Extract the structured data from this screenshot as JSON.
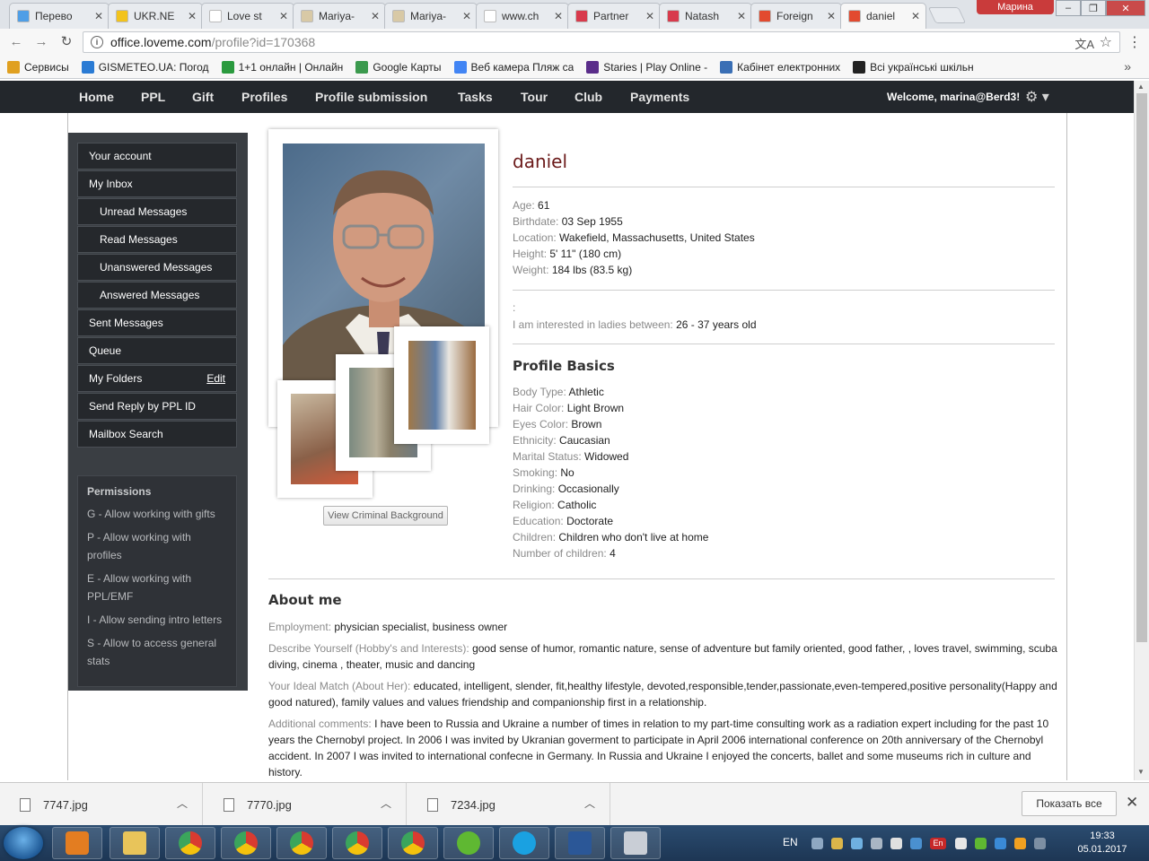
{
  "browser": {
    "tabs": [
      {
        "title": "Перево",
        "color": "#4f9ee6"
      },
      {
        "title": "UKR.NE",
        "color": "#f2c31c"
      },
      {
        "title": "Love st",
        "color": "#ffffff"
      },
      {
        "title": "Mariya-",
        "color": "#d8c9a6"
      },
      {
        "title": "Mariya-",
        "color": "#d8c9a6"
      },
      {
        "title": "www.ch",
        "color": "#ffffff"
      },
      {
        "title": "Partner",
        "color": "#d83a4c"
      },
      {
        "title": "Natash",
        "color": "#d83a4c"
      },
      {
        "title": "Foreign",
        "color": "#e24a2f"
      },
      {
        "title": "daniel",
        "color": "#e24a2f"
      }
    ],
    "profile_chip": "Марина",
    "url_host": "office.loveme.com",
    "url_path": "/profile?id=170368",
    "bookmarks": [
      {
        "label": "Сервисы",
        "color": "#e0a020"
      },
      {
        "label": "GISMETEO.UA: Погод",
        "color": "#2a7bd4"
      },
      {
        "label": "1+1 онлайн | Онлайн",
        "color": "#2a9a3e"
      },
      {
        "label": "Google Карты",
        "color": "#3b9a4e"
      },
      {
        "label": "Веб камера Пляж са",
        "color": "#4285f4"
      },
      {
        "label": "Staries | Play Online -",
        "color": "#5a2d8a"
      },
      {
        "label": "Кабінет електронних",
        "color": "#3a6fb5"
      },
      {
        "label": "Всі українські шкільн",
        "color": "#222222"
      }
    ]
  },
  "site": {
    "nav": [
      "Home",
      "PPL",
      "Gift",
      "Profiles",
      "Profile submission",
      "Tasks",
      "Tour",
      "Club",
      "Payments"
    ],
    "welcome": "Welcome, marina@Berd3!"
  },
  "sidebar": {
    "items": [
      {
        "label": "Your account",
        "sub": false
      },
      {
        "label": "My Inbox",
        "sub": false
      },
      {
        "label": "Unread Messages",
        "sub": true
      },
      {
        "label": "Read Messages",
        "sub": true
      },
      {
        "label": "Unanswered Messages",
        "sub": true
      },
      {
        "label": "Answered Messages",
        "sub": true
      },
      {
        "label": "Sent Messages",
        "sub": false
      },
      {
        "label": "Queue",
        "sub": false
      },
      {
        "label": "My Folders",
        "sub": false
      },
      {
        "label": "Send Reply by PPL ID",
        "sub": false
      },
      {
        "label": "Mailbox Search",
        "sub": false
      }
    ],
    "folders_edit": "Edit",
    "permissions_title": "Permissions",
    "permissions": [
      "G - Allow working with gifts",
      "P - Allow working with profiles",
      "E - Allow working with PPL/EMF",
      "I - Allow sending intro letters",
      "S - Allow to access general stats"
    ]
  },
  "profile": {
    "name": "daniel",
    "criminal_button": "View Criminal Background",
    "basics_1": [
      {
        "label": "Age:",
        "value": "61"
      },
      {
        "label": "Birthdate:",
        "value": "03 Sep 1955"
      },
      {
        "label": "Location:",
        "value": "Wakefield, Massachusetts, United States"
      },
      {
        "label": "Height:",
        "value": "5' 11\" (180 cm)"
      },
      {
        "label": "Weight:",
        "value": "184 lbs (83.5 kg)"
      }
    ],
    "colon_line": ":",
    "interest_label": "I am interested in ladies between:",
    "interest_value": "26 - 37 years old",
    "basics_title": "Profile Basics",
    "basics_2": [
      {
        "label": "Body Type:",
        "value": "Athletic"
      },
      {
        "label": "Hair Color:",
        "value": "Light Brown"
      },
      {
        "label": "Eyes Color:",
        "value": "Brown"
      },
      {
        "label": "Ethnicity:",
        "value": "Caucasian"
      },
      {
        "label": "Marital Status:",
        "value": "Widowed"
      },
      {
        "label": "Smoking:",
        "value": "No"
      },
      {
        "label": "Drinking:",
        "value": "Occasionally"
      },
      {
        "label": "Religion:",
        "value": "Catholic"
      },
      {
        "label": "Education:",
        "value": "Doctorate"
      },
      {
        "label": "Children:",
        "value": "Children who don't live at home"
      },
      {
        "label": "Number of children:",
        "value": "4"
      }
    ],
    "about_title": "About me",
    "about": [
      {
        "label": "Employment:",
        "value": "physician specialist, business owner"
      },
      {
        "label": "Describe Yourself (Hobby's and Interests):",
        "value": "good sense of humor, romantic nature, sense of adventure but family oriented, good father, , loves travel, swimming, scuba diving, cinema , theater, music and dancing"
      },
      {
        "label": "Your Ideal Match (About Her):",
        "value": "educated, intelligent, slender, fit,healthy lifestyle, devoted,responsible,tender,passionate,even-tempered,positive personality(Happy and good natured), family values and values friendship and companionship first in a relationship."
      },
      {
        "label": "Additional comments:",
        "value": "I have been to Russia and Ukraine a number of times in relation to my part-time consulting work as a radiation expert including for the past 10 years the Chernobyl project. In 2006 I was invited by Ukranian goverment to participate in April 2006 international conference on 20th anniversary of the Chernobyl accident. In 2007 I was invited to international confecne in Germany. In Russia and Ukraine I enjoyed the concerts, ballet and some museums rich in culture and history."
      }
    ]
  },
  "downloads": {
    "files": [
      "7747.jpg",
      "7770.jpg",
      "7234.jpg"
    ],
    "show_all": "Показать все"
  },
  "taskbar": {
    "lang": "EN",
    "tray_lang": "En",
    "time": "19:33",
    "date": "05.01.2017"
  }
}
